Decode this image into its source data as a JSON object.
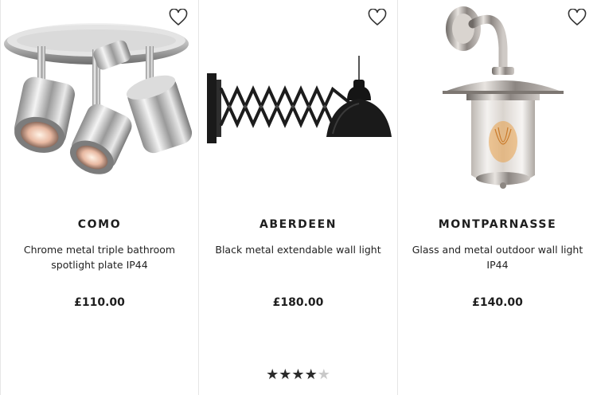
{
  "products": [
    {
      "name": "COMO",
      "description": "Chrome metal triple bathroom spotlight plate IP44",
      "price": "£110.00",
      "image": "chrome-triple-spotlight-image",
      "wishlist_icon": "heart-outline-icon"
    },
    {
      "name": "ABERDEEN",
      "description": "Black metal extendable wall light",
      "price": "£180.00",
      "image": "black-scissor-wall-light-image",
      "wishlist_icon": "heart-outline-icon",
      "rating": {
        "value": 4,
        "max": 5
      }
    },
    {
      "name": "MONTPARNASSE",
      "description": "Glass and metal outdoor wall light IP44",
      "price": "£140.00",
      "image": "glass-outdoor-lantern-image",
      "wishlist_icon": "heart-outline-icon"
    }
  ],
  "colors": {
    "text": "#1e1e1e",
    "star_filled": "#2b2b2b",
    "star_empty": "#c9c9c9",
    "divider": "#e6e6e6"
  }
}
